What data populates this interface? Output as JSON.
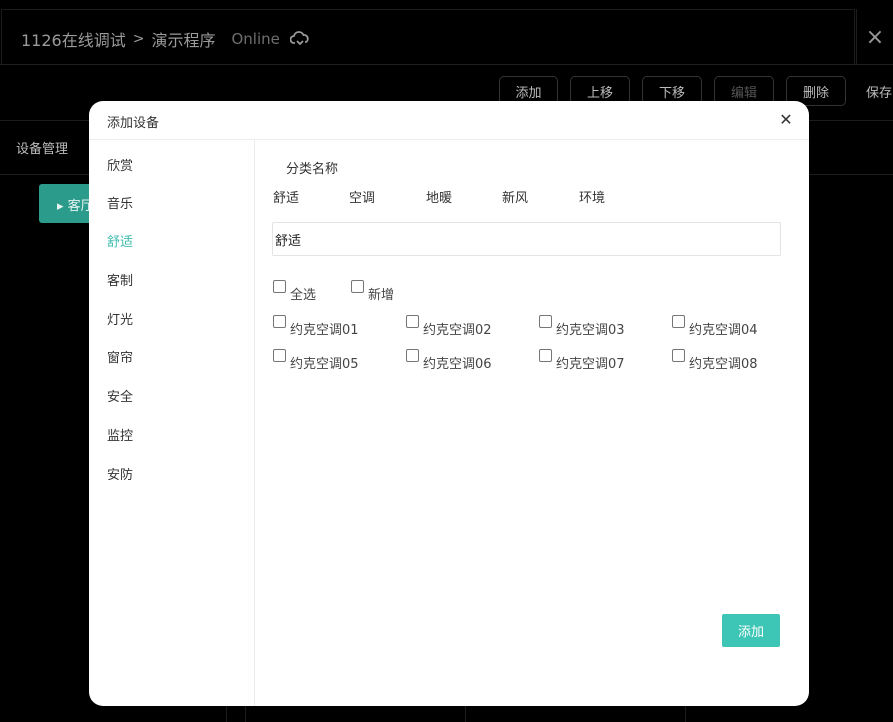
{
  "header": {
    "project": "1126在线调试",
    "separator": ">",
    "program": "演示程序",
    "status": "Online",
    "cloud_icon": "cloud-sync-icon",
    "close_label": "×"
  },
  "toolbar": {
    "add": "添加",
    "move_up": "上移",
    "move_down": "下移",
    "edit": "编辑",
    "delete": "删除",
    "save": "保存"
  },
  "tabs": {
    "device_management": "设备管理"
  },
  "room_chip": {
    "label": "▸ 客厅"
  },
  "modal": {
    "title": "添加设备",
    "close_label": "✕",
    "sidebar": [
      "欣赏",
      "音乐",
      "舒适",
      "客制",
      "灯光",
      "窗帘",
      "安全",
      "监控",
      "安防"
    ],
    "sidebar_active": "舒适",
    "category_label": "分类名称",
    "category_tabs": [
      "舒适",
      "空调",
      "地暖",
      "新风",
      "环境"
    ],
    "name_value": "舒适",
    "select_all": "全选",
    "add_new": "新增",
    "devices": [
      "约克空调01",
      "约克空调02",
      "约克空调03",
      "约克空调04",
      "约克空调05",
      "约克空调06",
      "约克空调07",
      "约克空调08"
    ],
    "add_button": "添加"
  },
  "colors": {
    "accent": "#3dc5b5",
    "active_text": "#3dbcae",
    "chip": "#2b9c8c"
  }
}
